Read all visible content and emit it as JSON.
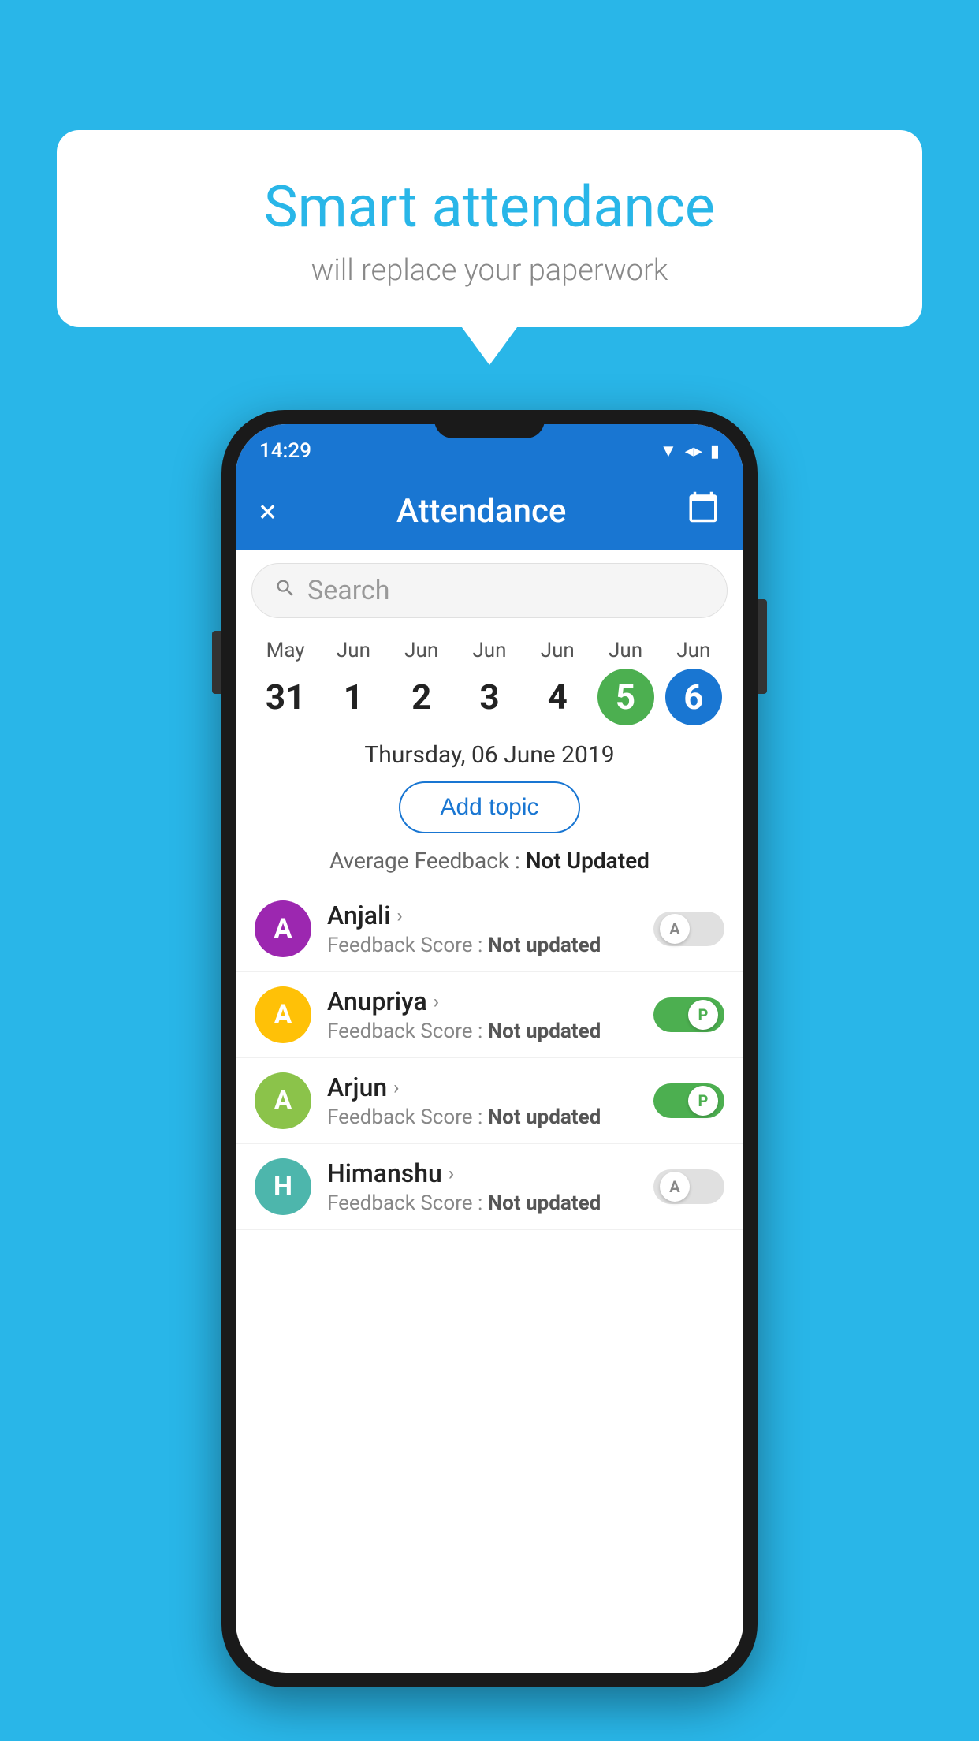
{
  "background_color": "#29B6E8",
  "bubble": {
    "title": "Smart attendance",
    "subtitle": "will replace your paperwork"
  },
  "status_bar": {
    "time": "14:29",
    "icons": [
      "wifi",
      "signal",
      "battery"
    ]
  },
  "app_bar": {
    "close_label": "×",
    "title": "Attendance",
    "calendar_icon": "📅"
  },
  "search": {
    "placeholder": "Search"
  },
  "calendar": {
    "days": [
      {
        "month": "May",
        "date": "31",
        "state": "normal"
      },
      {
        "month": "Jun",
        "date": "1",
        "state": "normal"
      },
      {
        "month": "Jun",
        "date": "2",
        "state": "normal"
      },
      {
        "month": "Jun",
        "date": "3",
        "state": "normal"
      },
      {
        "month": "Jun",
        "date": "4",
        "state": "normal"
      },
      {
        "month": "Jun",
        "date": "5",
        "state": "today"
      },
      {
        "month": "Jun",
        "date": "6",
        "state": "selected"
      }
    ]
  },
  "selected_date_label": "Thursday, 06 June 2019",
  "add_topic_label": "Add topic",
  "avg_feedback_label": "Average Feedback :",
  "avg_feedback_value": "Not Updated",
  "students": [
    {
      "name": "Anjali",
      "avatar_letter": "A",
      "avatar_color": "purple",
      "feedback_label": "Feedback Score :",
      "feedback_value": "Not updated",
      "toggle_state": "off",
      "toggle_label": "A"
    },
    {
      "name": "Anupriya",
      "avatar_letter": "A",
      "avatar_color": "yellow",
      "feedback_label": "Feedback Score :",
      "feedback_value": "Not updated",
      "toggle_state": "on",
      "toggle_label": "P"
    },
    {
      "name": "Arjun",
      "avatar_letter": "A",
      "avatar_color": "green",
      "feedback_label": "Feedback Score :",
      "feedback_value": "Not updated",
      "toggle_state": "on",
      "toggle_label": "P"
    },
    {
      "name": "Himanshu",
      "avatar_letter": "H",
      "avatar_color": "teal",
      "feedback_label": "Feedback Score :",
      "feedback_value": "Not updated",
      "toggle_state": "off",
      "toggle_label": "A"
    }
  ]
}
